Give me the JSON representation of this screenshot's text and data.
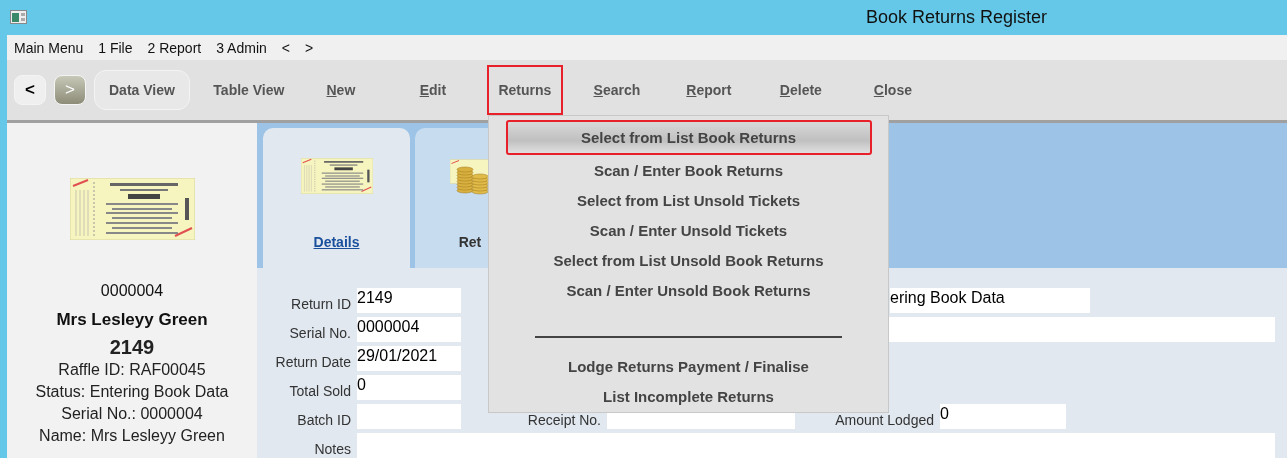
{
  "window": {
    "title": "Book Returns Register"
  },
  "menu_bar": {
    "items": [
      "Main Menu",
      "1 File",
      "2 Report",
      "3 Admin",
      "<",
      ">"
    ]
  },
  "toolbar": {
    "nav": [
      {
        "label": "<",
        "disabled": false
      },
      {
        "label": ">",
        "disabled": true
      }
    ],
    "buttons": [
      {
        "label": "Data View",
        "kind": "pill",
        "mnemonic": false,
        "selected": false
      },
      {
        "label": "Table View",
        "kind": "text",
        "mnemonic": false,
        "selected": false
      },
      {
        "label": "New",
        "kind": "text",
        "mnemonic": true,
        "selected": false
      },
      {
        "label": "Edit",
        "kind": "text",
        "mnemonic": true,
        "selected": false
      },
      {
        "label": "Returns",
        "kind": "text",
        "mnemonic": false,
        "selected": true
      },
      {
        "label": "Search",
        "kind": "text",
        "mnemonic": true,
        "selected": false
      },
      {
        "label": "Report",
        "kind": "text",
        "mnemonic": true,
        "selected": false
      },
      {
        "label": "Delete",
        "kind": "text",
        "mnemonic": true,
        "selected": false
      },
      {
        "label": "Close",
        "kind": "text",
        "mnemonic": true,
        "selected": false
      }
    ]
  },
  "returns_menu": {
    "items": [
      {
        "kind": "item",
        "label": "Select from List Book Returns",
        "selected": true
      },
      {
        "kind": "item",
        "label": "Scan / Enter Book Returns",
        "selected": false
      },
      {
        "kind": "item",
        "label": "Select from List Unsold Tickets",
        "selected": false
      },
      {
        "kind": "item",
        "label": "Scan / Enter Unsold Tickets",
        "selected": false
      },
      {
        "kind": "item",
        "label": "Select from List Unsold Book Returns",
        "selected": false
      },
      {
        "kind": "item",
        "label": "Scan / Enter Unsold Book Returns",
        "selected": false
      },
      {
        "kind": "separator"
      },
      {
        "kind": "item",
        "label": "Lodge Returns Payment / Finalise",
        "selected": false
      },
      {
        "kind": "item",
        "label": "List Incomplete Returns",
        "selected": false
      }
    ]
  },
  "summary": {
    "serial": "0000004",
    "name": "Mrs Lesleyy Green",
    "return_id": "2149",
    "lines": [
      "Raffle ID: RAF00045",
      "Status: Entering Book Data",
      "Serial No.: 0000004",
      "Name: Mrs Lesleyy Green"
    ]
  },
  "tabs": [
    {
      "label": "Details",
      "selected": true,
      "kind": "ticket"
    },
    {
      "label": "Ret",
      "selected": false,
      "kind": "coins"
    }
  ],
  "form": {
    "fields": [
      {
        "kind": "text",
        "label": "Return ID",
        "value": "2149"
      },
      {
        "kind": "text",
        "label": "Serial No.",
        "value": "0000004"
      },
      {
        "kind": "text",
        "label": "Return Date",
        "value": "29/01/2021"
      },
      {
        "kind": "text",
        "label": "Total Sold",
        "value": "0"
      },
      {
        "kind": "text",
        "label": "Batch ID"
      },
      {
        "kind": "text",
        "label": "Notes"
      }
    ],
    "side_fields": [
      {
        "kind": "text",
        "value": "ering Book Data"
      },
      {
        "kind": "text"
      },
      {
        "kind": "text",
        "label": "Receipt No."
      },
      {
        "kind": "text",
        "label": "Amount Lodged",
        "value": "0"
      }
    ]
  }
}
